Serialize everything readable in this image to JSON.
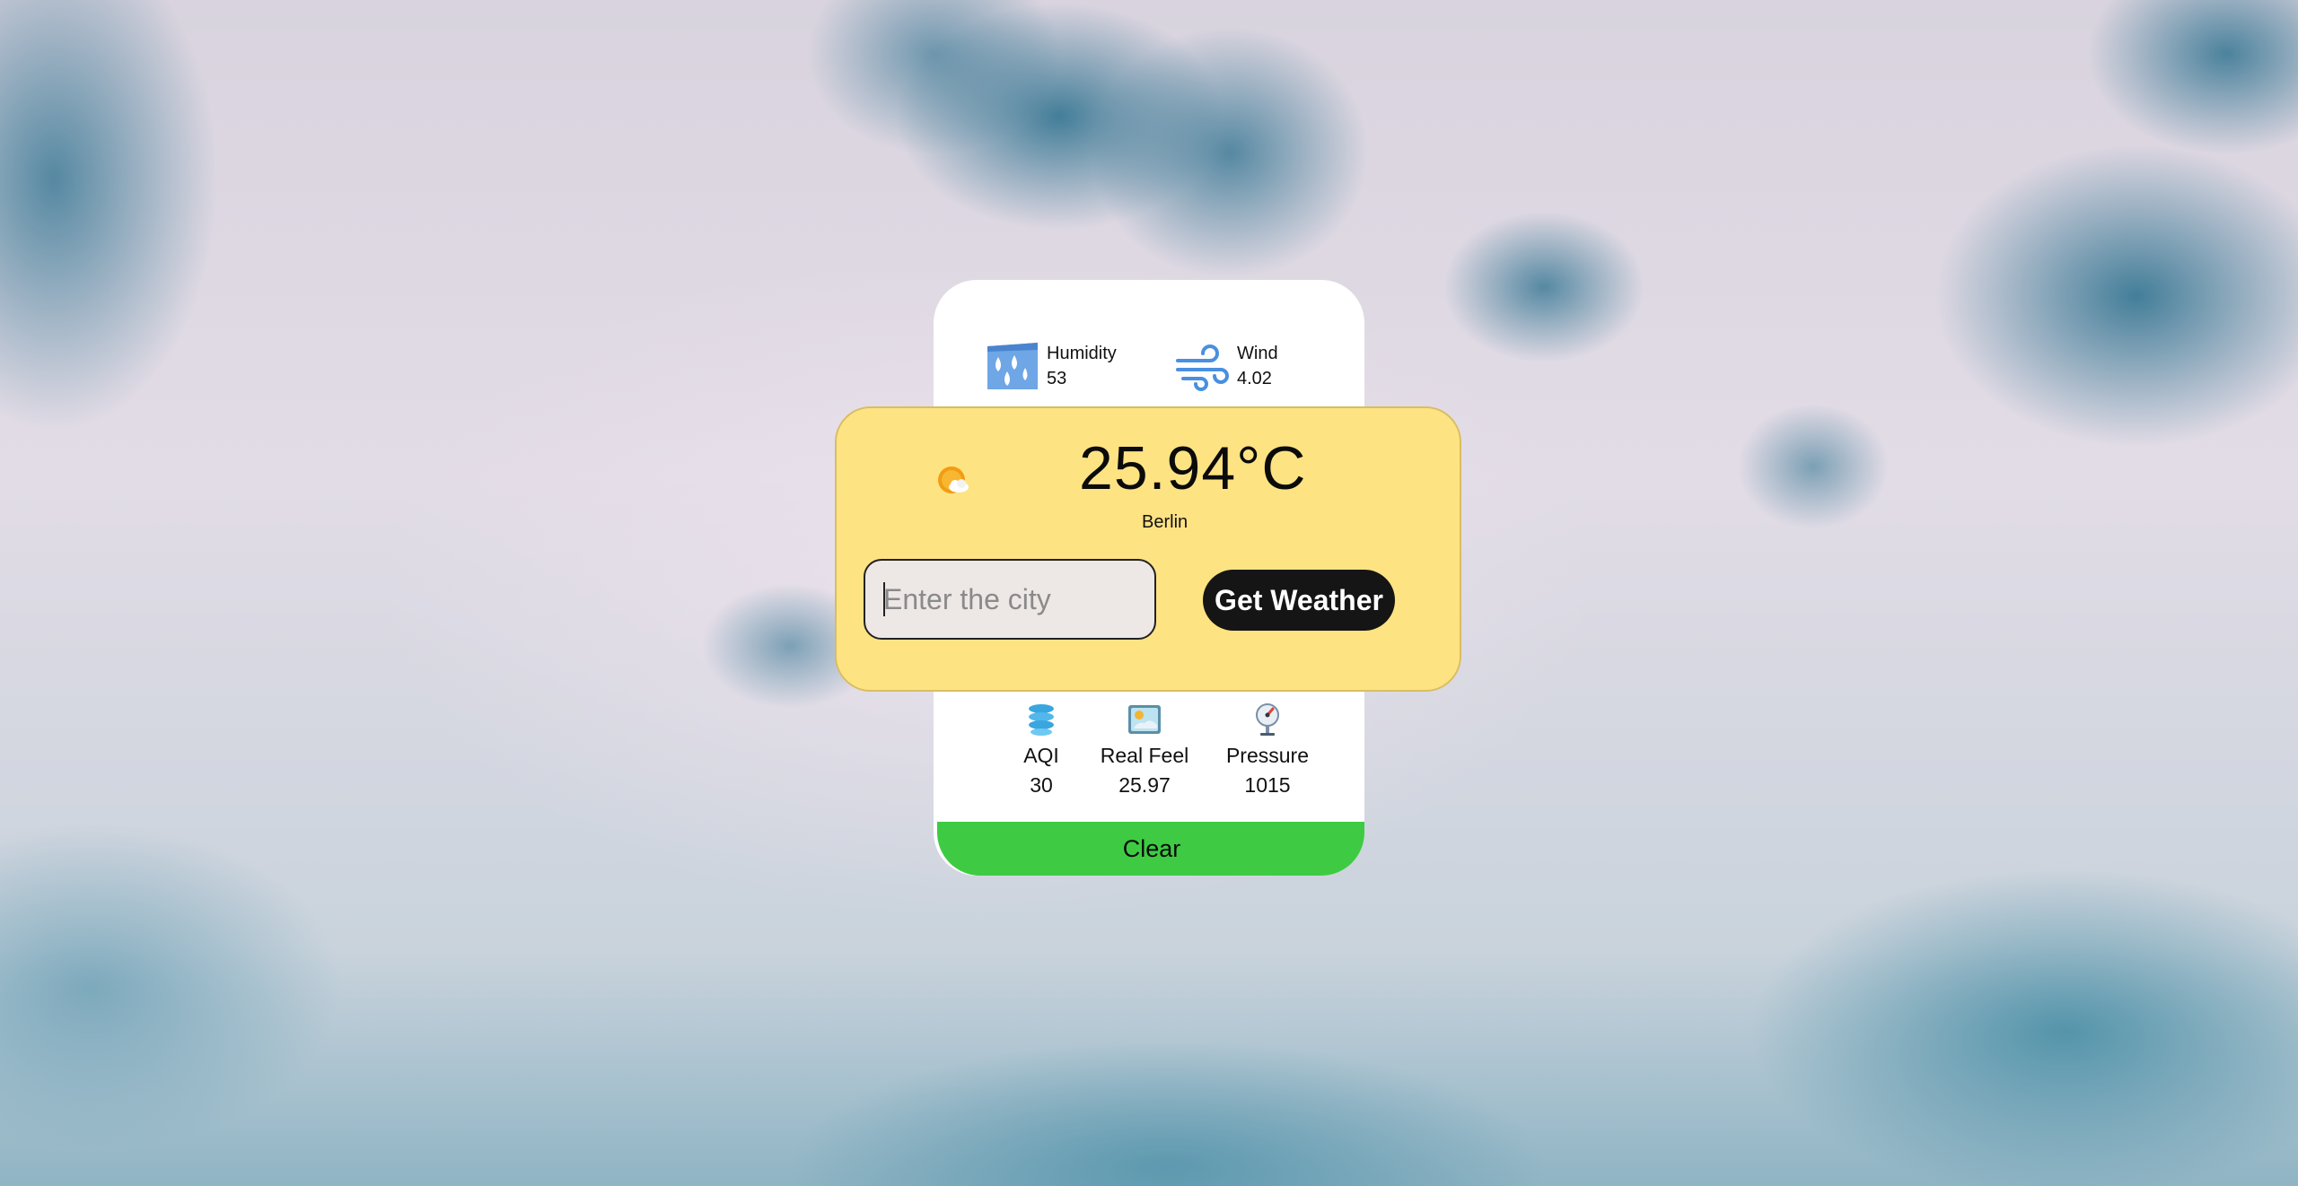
{
  "weather": {
    "temperature": "25.94°C",
    "city": "Berlin",
    "condition_icon": "sun-behind-cloud-icon"
  },
  "stats_top": {
    "humidity": {
      "label": "Humidity",
      "value": "53",
      "icon": "humidity-icon"
    },
    "wind": {
      "label": "Wind",
      "value": "4.02",
      "icon": "wind-icon"
    }
  },
  "stats_bottom": {
    "aqi": {
      "label": "AQI",
      "value": "30",
      "icon": "aqi-icon"
    },
    "real_feel": {
      "label": "Real Feel",
      "value": "25.97",
      "icon": "real-feel-icon"
    },
    "pressure": {
      "label": "Pressure",
      "value": "1015",
      "icon": "pressure-gauge-icon"
    }
  },
  "search": {
    "placeholder": "Enter the city",
    "value": "",
    "button_label": "Get Weather"
  },
  "clear_label": "Clear",
  "colors": {
    "panel_yellow": "#fee383",
    "button_dark": "#151515",
    "clear_green": "#3ecb43",
    "card_white": "#ffffff"
  }
}
